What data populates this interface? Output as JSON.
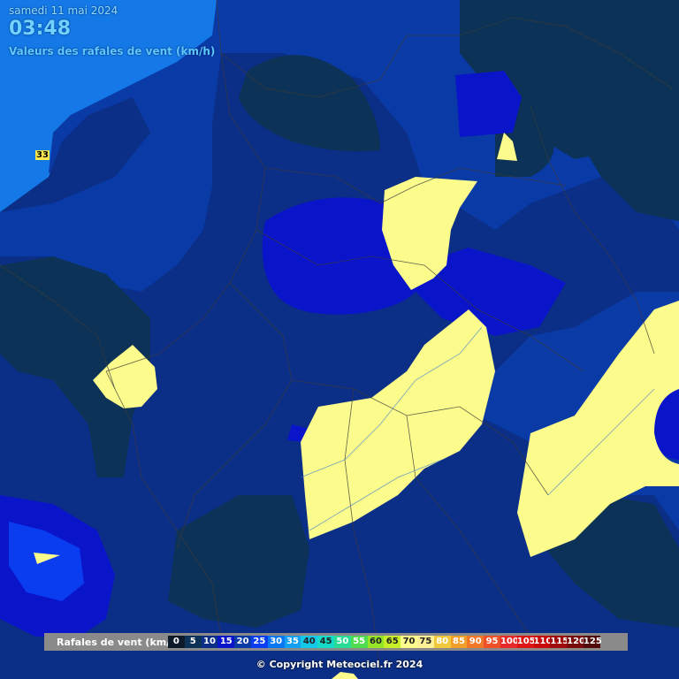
{
  "header": {
    "date": "samedi 11 mai 2024",
    "time": "03:48",
    "subtitle": "Valeurs des rafales de vent (km/h)"
  },
  "map": {
    "point_labels": [
      {
        "value": "33"
      }
    ],
    "colors": {
      "sea": "#1479e6",
      "gust_15_20": "#0a3aa6",
      "gust_10_15": "#0b2f86",
      "gust_5_10": "#0c3258",
      "gust_20_25": "#0a14c8",
      "gust_25_30": "#0a3cf0",
      "gust_70_75": "#fbfc8c",
      "borders": "#3a3a3a",
      "rivers": "#3a7ad0"
    }
  },
  "legend": {
    "title": "Rafales de vent (km/h)",
    "items": [
      {
        "label": "0",
        "color": "#0c1a2a"
      },
      {
        "label": "5",
        "color": "#0c3258"
      },
      {
        "label": "10",
        "color": "#0b2f86"
      },
      {
        "label": "15",
        "color": "#0a14c8"
      },
      {
        "label": "20",
        "color": "#0a3aa6"
      },
      {
        "label": "25",
        "color": "#0a3cf0"
      },
      {
        "label": "30",
        "color": "#0a78f0"
      },
      {
        "label": "35",
        "color": "#14a0f0"
      },
      {
        "label": "40",
        "color": "#14c8e8"
      },
      {
        "label": "45",
        "color": "#14dcc8"
      },
      {
        "label": "50",
        "color": "#28dc96"
      },
      {
        "label": "55",
        "color": "#50dc50"
      },
      {
        "label": "60",
        "color": "#96e628"
      },
      {
        "label": "65",
        "color": "#c8f028"
      },
      {
        "label": "70",
        "color": "#fbfc8c"
      },
      {
        "label": "75",
        "color": "#fff096"
      },
      {
        "label": "80",
        "color": "#f0c83c"
      },
      {
        "label": "85",
        "color": "#f0a028"
      },
      {
        "label": "90",
        "color": "#f07828"
      },
      {
        "label": "95",
        "color": "#f05028"
      },
      {
        "label": "100",
        "color": "#e62828"
      },
      {
        "label": "105",
        "color": "#dc1414"
      },
      {
        "label": "110",
        "color": "#c80a0a"
      },
      {
        "label": "115",
        "color": "#a00a0a"
      },
      {
        "label": "120",
        "color": "#780a0a"
      },
      {
        "label": "125",
        "color": "#500a0a"
      }
    ]
  },
  "copyright": "© Copyright Meteociel.fr 2024"
}
